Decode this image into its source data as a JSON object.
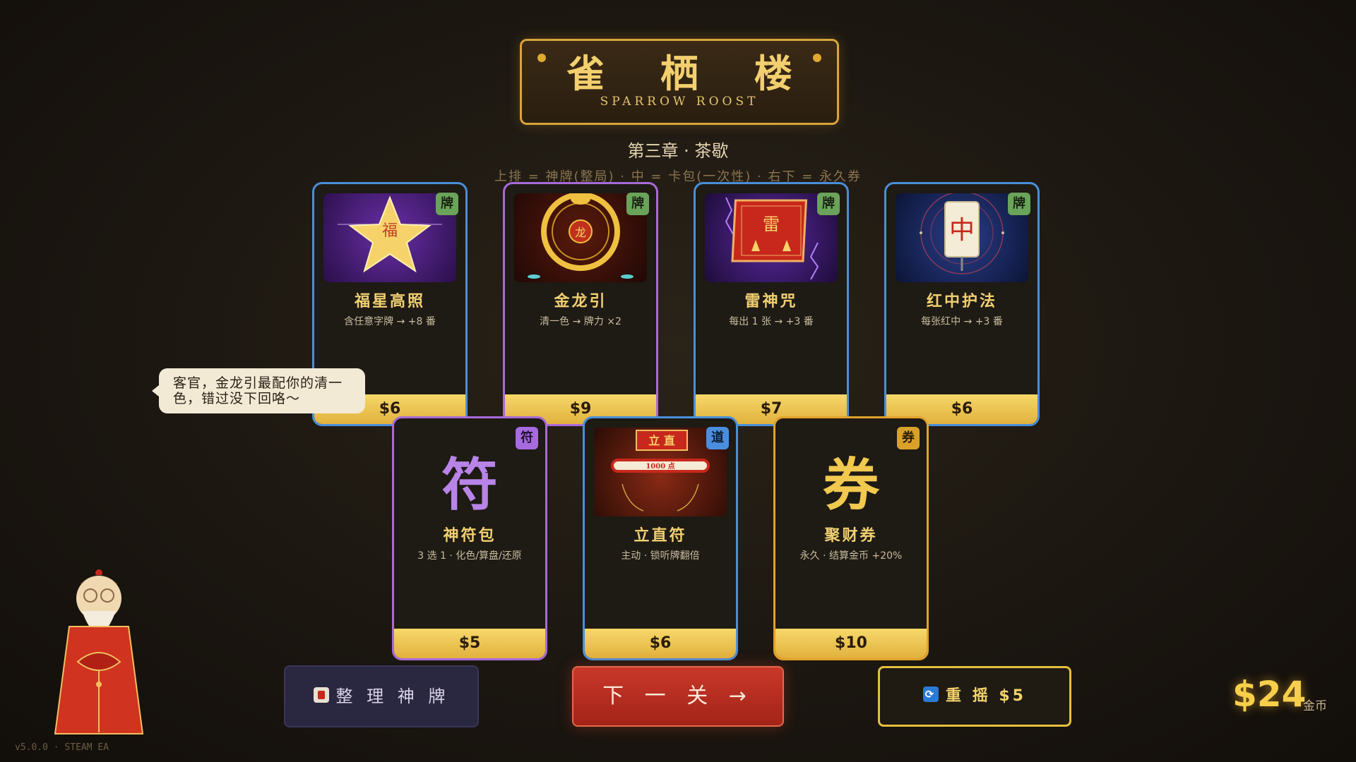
{
  "header": {
    "title": "雀 栖 楼",
    "subtitle": "SPARROW ROOST"
  },
  "chapter": "第三章 · 茶歇",
  "hint": "上排 = 神牌(整局) · 中 = 卡包(一次性) · 右下 = 永久券",
  "cards_top": [
    {
      "name": "福星高照",
      "desc": "含任意字牌 → +8 番",
      "price": "$6",
      "badge": "牌",
      "art_label": "福"
    },
    {
      "name": "金龙引",
      "desc": "清一色 → 牌力 ×2",
      "price": "$9",
      "badge": "牌",
      "art_label": "龙"
    },
    {
      "name": "雷神咒",
      "desc": "每出 1 张 → +3 番",
      "price": "$7",
      "badge": "牌",
      "art_label": "雷"
    },
    {
      "name": "红中护法",
      "desc": "每张红中 → +3 番",
      "price": "$6",
      "badge": "牌",
      "art_label": "中"
    }
  ],
  "cards_bottom": [
    {
      "name": "神符包",
      "desc": "3 选 1 · 化色/算盘/还原",
      "price": "$5",
      "badge": "符",
      "glyph": "符"
    },
    {
      "name": "立直符",
      "desc": "主动 · 锁听牌翻倍",
      "price": "$6",
      "badge": "道",
      "art_title": "立 直",
      "art_stick": "1000 点"
    },
    {
      "name": "聚财券",
      "desc": "永久 · 结算金币 +20%",
      "price": "$10",
      "badge": "券",
      "glyph": "券"
    }
  ],
  "speech": "客官，金龙引最配你的清一色，错过没下回咯～",
  "buttons": {
    "deck": "整 理 神 牌",
    "next": "下 一 关 →",
    "reroll": "重 摇 $5"
  },
  "money": {
    "amount": "$24",
    "label": "金币"
  },
  "version": "v5.0.0 · STEAM EA",
  "colors": {
    "blue_border": "#4a8fd8",
    "purple_border": "#a86ad8",
    "gold_border": "#e2a22b",
    "price_bar": "#f1c94f",
    "next_button": "#c0321f"
  }
}
